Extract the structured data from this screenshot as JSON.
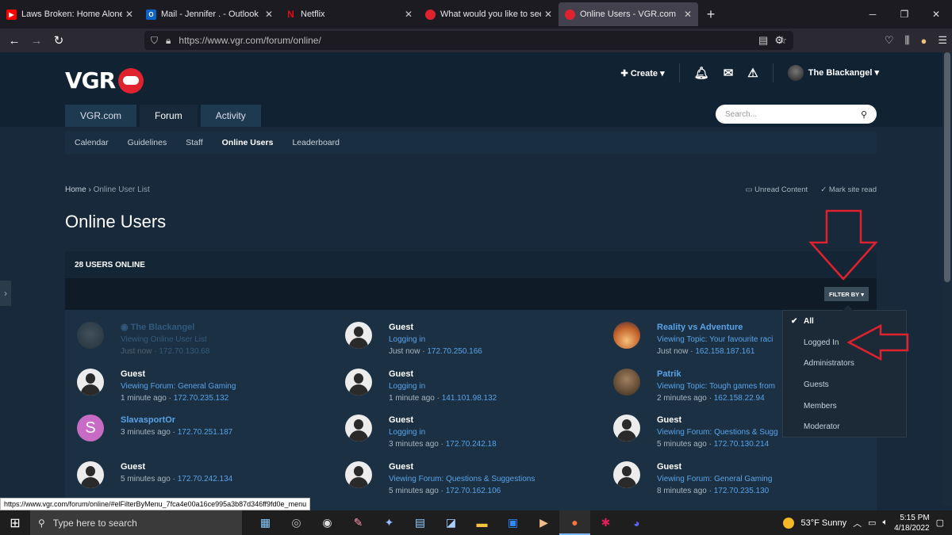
{
  "browser": {
    "tabs": [
      {
        "title": "Laws Broken: Home Alone - You",
        "icon": "youtube-icon",
        "color": "#ff0000"
      },
      {
        "title": "Mail - Jennifer . - Outlook",
        "icon": "outlook-icon",
        "color": "#0a64c8"
      },
      {
        "title": "Netflix",
        "icon": "netflix-icon",
        "color": "#e50914"
      },
      {
        "title": "What would you like to see add",
        "icon": "vgr-icon",
        "color": "#e0212e"
      },
      {
        "title": "Online Users - VGR.com",
        "icon": "vgr-icon",
        "color": "#e0212e"
      }
    ],
    "url": "https://www.vgr.com/forum/online/",
    "status_url": "https://www.vgr.com/forum/online/#elFilterByMenu_7fca4e00a16ce995a3b87d346ff9fd0e_menu"
  },
  "site": {
    "logo_text": "VGR",
    "create_label": "Create",
    "username": "The Blackangel",
    "main_tabs": [
      {
        "label": "VGR.com"
      },
      {
        "label": "Forum"
      },
      {
        "label": "Activity"
      }
    ],
    "search_placeholder": "Search...",
    "sub_nav": [
      {
        "label": "Calendar"
      },
      {
        "label": "Guidelines"
      },
      {
        "label": "Staff"
      },
      {
        "label": "Online Users"
      },
      {
        "label": "Leaderboard"
      }
    ],
    "breadcrumb": {
      "home": "Home",
      "current": "Online User List"
    },
    "unread_content": "Unread Content",
    "mark_site_read": "Mark site read",
    "page_title": "Online Users",
    "users_online": "28 USERS ONLINE",
    "filter_by": "FILTER BY",
    "filter_options": [
      {
        "label": "All"
      },
      {
        "label": "Logged In"
      },
      {
        "label": "Administrators"
      },
      {
        "label": "Guests"
      },
      {
        "label": "Members"
      },
      {
        "label": "Moderator"
      }
    ],
    "users": [
      {
        "name": "The Blackangel",
        "activity": "Viewing Online User List",
        "time": "Just now",
        "ip": "172.70.130.68"
      },
      {
        "name": "Guest",
        "activity": "Logging in",
        "time": "Just now",
        "ip": "172.70.250.166"
      },
      {
        "name": "Reality vs Adventure",
        "activity": "Viewing Topic: Your favourite raci",
        "time": "Just now",
        "ip": "162.158.187.161"
      },
      {
        "name": "Guest",
        "activity": "Viewing Forum: General Gaming",
        "time": "1 minute ago",
        "ip": "172.70.235.132"
      },
      {
        "name": "Guest",
        "activity": "Logging in",
        "time": "1 minute ago",
        "ip": "141.101.98.132"
      },
      {
        "name": "Patrik",
        "activity": "Viewing Topic: Tough games from",
        "time": "2 minutes ago",
        "ip": "162.158.22.94"
      },
      {
        "name": "SlavasportOr",
        "activity": "",
        "time": "3 minutes ago",
        "ip": "172.70.251.187",
        "letter": "S"
      },
      {
        "name": "Guest",
        "activity": "Logging in",
        "time": "3 minutes ago",
        "ip": "172.70.242.18"
      },
      {
        "name": "Guest",
        "activity": "Viewing Forum: Questions & Sugg",
        "time": "5 minutes ago",
        "ip": "172.70.130.214"
      },
      {
        "name": "Guest",
        "activity": "",
        "time": "5 minutes ago",
        "ip": "172.70.242.134"
      },
      {
        "name": "Guest",
        "activity": "Viewing Forum: Questions & Suggestions",
        "time": "5 minutes ago",
        "ip": "172.70.162.106"
      },
      {
        "name": "Guest",
        "activity": "Viewing Forum: General Gaming",
        "time": "8 minutes ago",
        "ip": "172.70.235.130"
      }
    ]
  },
  "taskbar": {
    "search_placeholder": "Type here to search",
    "weather": "53°F  Sunny",
    "time": "5:15 PM",
    "date": "4/18/2022"
  },
  "colors": {
    "accent": "#5aa2e8",
    "annotation": "#e0212e",
    "header_bg": "#112333",
    "page_bg": "#17293a"
  }
}
